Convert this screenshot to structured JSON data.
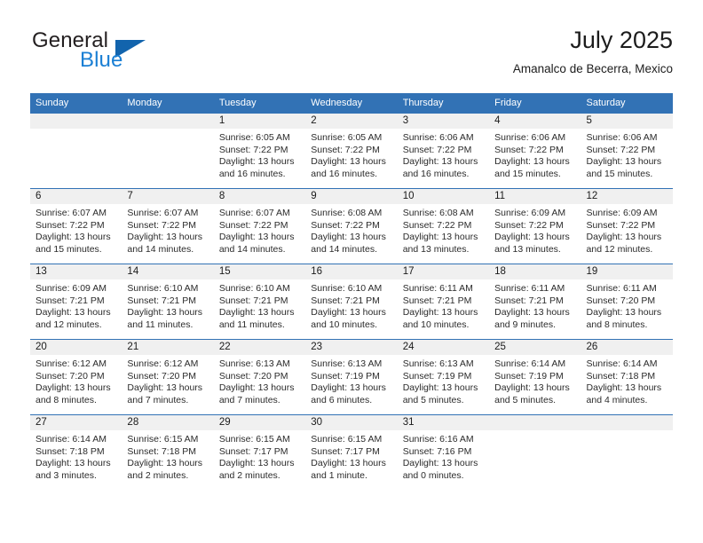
{
  "brand": {
    "line1": "General",
    "line2": "Blue",
    "triangle_icon": "triangle-logo-icon",
    "accent_color": "#1264ad",
    "blue_text_color": "#1a7fd4"
  },
  "header": {
    "title": "July 2025",
    "subtitle": "Amanalco de Becerra, Mexico"
  },
  "theme": {
    "header_blue": "#3272b5",
    "daynum_band": "#f0f0f0",
    "text": "#1a1a1a"
  },
  "weekday_headers": [
    "Sunday",
    "Monday",
    "Tuesday",
    "Wednesday",
    "Thursday",
    "Friday",
    "Saturday"
  ],
  "labels": {
    "sunrise_prefix": "Sunrise:",
    "sunset_prefix": "Sunset:",
    "daylight_prefix": "Daylight:"
  },
  "weeks": [
    [
      {
        "day": "",
        "sunrise": "",
        "sunset": "",
        "daylight_line1": "",
        "daylight_line2": "",
        "empty": true
      },
      {
        "day": "",
        "sunrise": "",
        "sunset": "",
        "daylight_line1": "",
        "daylight_line2": "",
        "empty": true
      },
      {
        "day": "1",
        "sunrise": "Sunrise: 6:05 AM",
        "sunset": "Sunset: 7:22 PM",
        "daylight_line1": "Daylight: 13 hours",
        "daylight_line2": "and 16 minutes."
      },
      {
        "day": "2",
        "sunrise": "Sunrise: 6:05 AM",
        "sunset": "Sunset: 7:22 PM",
        "daylight_line1": "Daylight: 13 hours",
        "daylight_line2": "and 16 minutes."
      },
      {
        "day": "3",
        "sunrise": "Sunrise: 6:06 AM",
        "sunset": "Sunset: 7:22 PM",
        "daylight_line1": "Daylight: 13 hours",
        "daylight_line2": "and 16 minutes."
      },
      {
        "day": "4",
        "sunrise": "Sunrise: 6:06 AM",
        "sunset": "Sunset: 7:22 PM",
        "daylight_line1": "Daylight: 13 hours",
        "daylight_line2": "and 15 minutes."
      },
      {
        "day": "5",
        "sunrise": "Sunrise: 6:06 AM",
        "sunset": "Sunset: 7:22 PM",
        "daylight_line1": "Daylight: 13 hours",
        "daylight_line2": "and 15 minutes."
      }
    ],
    [
      {
        "day": "6",
        "sunrise": "Sunrise: 6:07 AM",
        "sunset": "Sunset: 7:22 PM",
        "daylight_line1": "Daylight: 13 hours",
        "daylight_line2": "and 15 minutes."
      },
      {
        "day": "7",
        "sunrise": "Sunrise: 6:07 AM",
        "sunset": "Sunset: 7:22 PM",
        "daylight_line1": "Daylight: 13 hours",
        "daylight_line2": "and 14 minutes."
      },
      {
        "day": "8",
        "sunrise": "Sunrise: 6:07 AM",
        "sunset": "Sunset: 7:22 PM",
        "daylight_line1": "Daylight: 13 hours",
        "daylight_line2": "and 14 minutes."
      },
      {
        "day": "9",
        "sunrise": "Sunrise: 6:08 AM",
        "sunset": "Sunset: 7:22 PM",
        "daylight_line1": "Daylight: 13 hours",
        "daylight_line2": "and 14 minutes."
      },
      {
        "day": "10",
        "sunrise": "Sunrise: 6:08 AM",
        "sunset": "Sunset: 7:22 PM",
        "daylight_line1": "Daylight: 13 hours",
        "daylight_line2": "and 13 minutes."
      },
      {
        "day": "11",
        "sunrise": "Sunrise: 6:09 AM",
        "sunset": "Sunset: 7:22 PM",
        "daylight_line1": "Daylight: 13 hours",
        "daylight_line2": "and 13 minutes."
      },
      {
        "day": "12",
        "sunrise": "Sunrise: 6:09 AM",
        "sunset": "Sunset: 7:22 PM",
        "daylight_line1": "Daylight: 13 hours",
        "daylight_line2": "and 12 minutes."
      }
    ],
    [
      {
        "day": "13",
        "sunrise": "Sunrise: 6:09 AM",
        "sunset": "Sunset: 7:21 PM",
        "daylight_line1": "Daylight: 13 hours",
        "daylight_line2": "and 12 minutes."
      },
      {
        "day": "14",
        "sunrise": "Sunrise: 6:10 AM",
        "sunset": "Sunset: 7:21 PM",
        "daylight_line1": "Daylight: 13 hours",
        "daylight_line2": "and 11 minutes."
      },
      {
        "day": "15",
        "sunrise": "Sunrise: 6:10 AM",
        "sunset": "Sunset: 7:21 PM",
        "daylight_line1": "Daylight: 13 hours",
        "daylight_line2": "and 11 minutes."
      },
      {
        "day": "16",
        "sunrise": "Sunrise: 6:10 AM",
        "sunset": "Sunset: 7:21 PM",
        "daylight_line1": "Daylight: 13 hours",
        "daylight_line2": "and 10 minutes."
      },
      {
        "day": "17",
        "sunrise": "Sunrise: 6:11 AM",
        "sunset": "Sunset: 7:21 PM",
        "daylight_line1": "Daylight: 13 hours",
        "daylight_line2": "and 10 minutes."
      },
      {
        "day": "18",
        "sunrise": "Sunrise: 6:11 AM",
        "sunset": "Sunset: 7:21 PM",
        "daylight_line1": "Daylight: 13 hours",
        "daylight_line2": "and 9 minutes."
      },
      {
        "day": "19",
        "sunrise": "Sunrise: 6:11 AM",
        "sunset": "Sunset: 7:20 PM",
        "daylight_line1": "Daylight: 13 hours",
        "daylight_line2": "and 8 minutes."
      }
    ],
    [
      {
        "day": "20",
        "sunrise": "Sunrise: 6:12 AM",
        "sunset": "Sunset: 7:20 PM",
        "daylight_line1": "Daylight: 13 hours",
        "daylight_line2": "and 8 minutes."
      },
      {
        "day": "21",
        "sunrise": "Sunrise: 6:12 AM",
        "sunset": "Sunset: 7:20 PM",
        "daylight_line1": "Daylight: 13 hours",
        "daylight_line2": "and 7 minutes."
      },
      {
        "day": "22",
        "sunrise": "Sunrise: 6:13 AM",
        "sunset": "Sunset: 7:20 PM",
        "daylight_line1": "Daylight: 13 hours",
        "daylight_line2": "and 7 minutes."
      },
      {
        "day": "23",
        "sunrise": "Sunrise: 6:13 AM",
        "sunset": "Sunset: 7:19 PM",
        "daylight_line1": "Daylight: 13 hours",
        "daylight_line2": "and 6 minutes."
      },
      {
        "day": "24",
        "sunrise": "Sunrise: 6:13 AM",
        "sunset": "Sunset: 7:19 PM",
        "daylight_line1": "Daylight: 13 hours",
        "daylight_line2": "and 5 minutes."
      },
      {
        "day": "25",
        "sunrise": "Sunrise: 6:14 AM",
        "sunset": "Sunset: 7:19 PM",
        "daylight_line1": "Daylight: 13 hours",
        "daylight_line2": "and 5 minutes."
      },
      {
        "day": "26",
        "sunrise": "Sunrise: 6:14 AM",
        "sunset": "Sunset: 7:18 PM",
        "daylight_line1": "Daylight: 13 hours",
        "daylight_line2": "and 4 minutes."
      }
    ],
    [
      {
        "day": "27",
        "sunrise": "Sunrise: 6:14 AM",
        "sunset": "Sunset: 7:18 PM",
        "daylight_line1": "Daylight: 13 hours",
        "daylight_line2": "and 3 minutes."
      },
      {
        "day": "28",
        "sunrise": "Sunrise: 6:15 AM",
        "sunset": "Sunset: 7:18 PM",
        "daylight_line1": "Daylight: 13 hours",
        "daylight_line2": "and 2 minutes."
      },
      {
        "day": "29",
        "sunrise": "Sunrise: 6:15 AM",
        "sunset": "Sunset: 7:17 PM",
        "daylight_line1": "Daylight: 13 hours",
        "daylight_line2": "and 2 minutes."
      },
      {
        "day": "30",
        "sunrise": "Sunrise: 6:15 AM",
        "sunset": "Sunset: 7:17 PM",
        "daylight_line1": "Daylight: 13 hours",
        "daylight_line2": "and 1 minute."
      },
      {
        "day": "31",
        "sunrise": "Sunrise: 6:16 AM",
        "sunset": "Sunset: 7:16 PM",
        "daylight_line1": "Daylight: 13 hours",
        "daylight_line2": "and 0 minutes."
      },
      {
        "day": "",
        "sunrise": "",
        "sunset": "",
        "daylight_line1": "",
        "daylight_line2": "",
        "empty": true
      },
      {
        "day": "",
        "sunrise": "",
        "sunset": "",
        "daylight_line1": "",
        "daylight_line2": "",
        "empty": true
      }
    ]
  ]
}
